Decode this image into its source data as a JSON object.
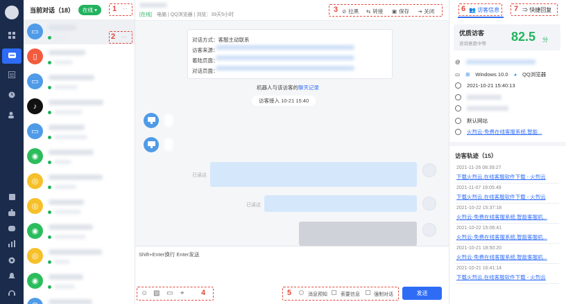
{
  "colors": {
    "nav_bg": "#1a2b4c",
    "accent": "#2e6cf6",
    "online": "#22b35e",
    "annotation": "#e0483a",
    "score": "#22b35e"
  },
  "nav": {
    "icons": [
      "avatar",
      "dashboard-icon",
      "chat-icon",
      "list-icon",
      "clock-icon",
      "contacts-icon",
      "clipboard-icon",
      "robot-icon",
      "bot-icon",
      "chart-icon",
      "settings-icon",
      "bell-icon",
      "headset-icon"
    ]
  },
  "list": {
    "title": "当前对话（18）",
    "status": "在线",
    "rows": [
      {
        "icon": "desktop",
        "color": "#4f9be8"
      },
      {
        "icon": "mobile",
        "color": "#f35b3f"
      },
      {
        "icon": "desktop",
        "color": "#4f9be8"
      },
      {
        "icon": "tiktok",
        "color": "#111111"
      },
      {
        "icon": "desktop",
        "color": "#4f9be8"
      },
      {
        "icon": "wechat",
        "color": "#2bbd5c"
      },
      {
        "icon": "weibo",
        "color": "#f6c02a"
      },
      {
        "icon": "weibo",
        "color": "#f6c02a"
      },
      {
        "icon": "wechat",
        "color": "#2bbd5c"
      },
      {
        "icon": "weibo",
        "color": "#f6c02a"
      },
      {
        "icon": "wechat",
        "color": "#2bbd5c"
      },
      {
        "icon": "headset",
        "color": "#4f9be8"
      }
    ]
  },
  "header": {
    "status": "[在线]",
    "meta": "电脑 | QQ浏览器 | 浏览：39天5小时",
    "actions": [
      "拉黑",
      "转接",
      "保存",
      "关闭"
    ]
  },
  "card": {
    "lines": [
      "对话方式：客服主动联系",
      "访客来源：",
      "着陆页面：",
      "对话页面："
    ]
  },
  "messages": {
    "robot_text": "机器人与该访客的",
    "robot_link": "聊天记录",
    "access": "访客接入 10-21 15:40",
    "read": "已读达",
    "read2": "已读达"
  },
  "input": {
    "placeholder": "Shift+Enter换行 Enter发送",
    "options": [
      "消息预知",
      "索要信息",
      "强制对话"
    ],
    "send": "发送"
  },
  "side": {
    "tabs": [
      "访客信息",
      "快捷回复"
    ],
    "quality": "优质访客",
    "quality_sub": "咨询意愿中等",
    "score": "82.5",
    "score_unit": "分",
    "info": {
      "os": "Windows 10.0",
      "browser": "QQ浏览器",
      "time": "2021-10-21 15:40:13",
      "site": "默认网站",
      "page": "火烈云-免费在线客服系统,智能..."
    },
    "track_title": "访客轨迹（15）",
    "track": [
      {
        "time": "2021-11-26 08:39:27",
        "link": "下载火烈云,在线客服软件下载 - 火烈云"
      },
      {
        "time": "2021-11-07 19:05:49",
        "link": "下载火烈云,在线客服软件下载 - 火烈云"
      },
      {
        "time": "2021-10-22 15:37:18",
        "link": "火烈云-免费在线客服系统,智能客服机..."
      },
      {
        "time": "2021-10-22 15:06:41",
        "link": "火烈云-免费在线客服系统,智能客服机..."
      },
      {
        "time": "2021-10-21 18:50:20",
        "link": "火烈云-免费在线客服系统,智能客服机..."
      },
      {
        "time": "2021-10-21 16:41:14",
        "link": "下载火烈云,在线客服软件下载 - 火烈云"
      }
    ]
  },
  "annotations": [
    "1",
    "2",
    "3",
    "4",
    "5",
    "6",
    "7"
  ]
}
